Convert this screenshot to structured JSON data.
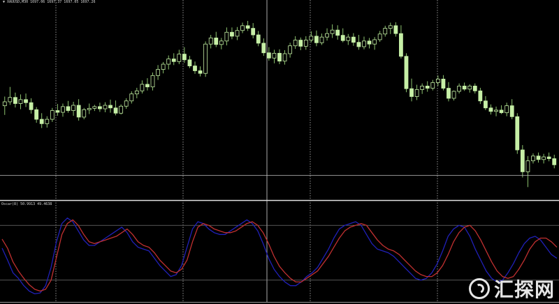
{
  "main_chart": {
    "label": "XAUUSD,M30  1697.06 1697.37 1697.05 1697.26",
    "theme": {
      "background": "#000000",
      "candle": "#c6efa6",
      "wick": "#9bd67a",
      "grid": "#d0d0d0"
    }
  },
  "oscillator": {
    "label": "Oscar(8) 50.9913 49.4638",
    "levels": [
      20,
      80
    ],
    "main_line_color": "#c03030",
    "signal_line_color": "#2020b8"
  },
  "watermark": {
    "text": "汇探网",
    "logo_icon": "ring-logo-icon"
  },
  "chart_data": {
    "type": "candlestick",
    "title": "XAUUSD,M30",
    "price_levels": {
      "top": 1712.0,
      "bottom": 1668.0
    },
    "horizontal_line": 1673.2,
    "candles": [
      [
        1689.1,
        1691.2,
        1687.0,
        1690.0
      ],
      [
        1690.0,
        1693.4,
        1689.3,
        1691.0
      ],
      [
        1691.0,
        1692.1,
        1688.7,
        1689.6
      ],
      [
        1689.6,
        1691.7,
        1688.3,
        1690.5
      ],
      [
        1690.5,
        1691.9,
        1688.8,
        1689.8
      ],
      [
        1689.8,
        1690.8,
        1687.3,
        1688.2
      ],
      [
        1688.2,
        1688.8,
        1685.2,
        1686.0
      ],
      [
        1686.0,
        1687.4,
        1684.0,
        1685.0
      ],
      [
        1685.0,
        1686.7,
        1684.1,
        1686.0
      ],
      [
        1686.0,
        1688.6,
        1685.4,
        1688.0
      ],
      [
        1688.0,
        1689.5,
        1686.8,
        1687.6
      ],
      [
        1687.6,
        1689.6,
        1686.6,
        1688.9
      ],
      [
        1688.9,
        1690.2,
        1687.5,
        1688.0
      ],
      [
        1688.0,
        1690.0,
        1686.8,
        1689.2
      ],
      [
        1689.2,
        1690.6,
        1685.7,
        1686.5
      ],
      [
        1686.5,
        1688.6,
        1686.0,
        1688.2
      ],
      [
        1688.2,
        1689.6,
        1687.2,
        1688.5
      ],
      [
        1688.5,
        1689.3,
        1687.9,
        1688.9
      ],
      [
        1688.9,
        1689.8,
        1687.7,
        1688.4
      ],
      [
        1688.4,
        1689.9,
        1687.6,
        1689.2
      ],
      [
        1689.2,
        1690.5,
        1687.5,
        1688.6
      ],
      [
        1688.6,
        1690.3,
        1686.9,
        1687.4
      ],
      [
        1687.4,
        1689.4,
        1687.1,
        1689.0
      ],
      [
        1689.0,
        1690.8,
        1688.4,
        1690.2
      ],
      [
        1690.2,
        1692.4,
        1689.6,
        1691.8
      ],
      [
        1691.8,
        1693.2,
        1690.8,
        1692.5
      ],
      [
        1692.5,
        1694.9,
        1691.9,
        1694.0
      ],
      [
        1694.0,
        1695.4,
        1692.6,
        1693.4
      ],
      [
        1693.4,
        1696.7,
        1692.6,
        1696.0
      ],
      [
        1696.0,
        1698.4,
        1695.0,
        1697.4
      ],
      [
        1697.4,
        1699.1,
        1696.5,
        1698.6
      ],
      [
        1698.6,
        1700.6,
        1697.4,
        1699.8
      ],
      [
        1699.8,
        1701.1,
        1698.4,
        1699.2
      ],
      [
        1699.2,
        1701.9,
        1698.6,
        1700.9
      ],
      [
        1700.9,
        1702.5,
        1698.9,
        1699.6
      ],
      [
        1699.6,
        1700.5,
        1697.7,
        1698.2
      ],
      [
        1698.2,
        1699.2,
        1696.4,
        1697.1
      ],
      [
        1697.1,
        1698.1,
        1695.8,
        1696.5
      ],
      [
        1696.5,
        1703.8,
        1695.7,
        1703.2
      ],
      [
        1703.2,
        1705.3,
        1702.2,
        1704.6
      ],
      [
        1704.6,
        1706.0,
        1702.5,
        1703.1
      ],
      [
        1703.1,
        1704.6,
        1702.0,
        1703.9
      ],
      [
        1703.9,
        1707.0,
        1702.9,
        1705.9
      ],
      [
        1705.9,
        1707.0,
        1704.3,
        1705.0
      ],
      [
        1705.0,
        1707.1,
        1704.1,
        1706.3
      ],
      [
        1706.3,
        1708.1,
        1705.7,
        1707.4
      ],
      [
        1707.4,
        1708.5,
        1706.2,
        1706.8
      ],
      [
        1706.8,
        1708.0,
        1704.5,
        1705.3
      ],
      [
        1705.3,
        1706.2,
        1702.7,
        1703.4
      ],
      [
        1703.4,
        1704.5,
        1700.5,
        1701.2
      ],
      [
        1701.2,
        1702.5,
        1699.4,
        1700.0
      ],
      [
        1700.0,
        1701.9,
        1698.8,
        1701.1
      ],
      [
        1701.1,
        1702.0,
        1698.6,
        1699.3
      ],
      [
        1699.3,
        1701.8,
        1698.5,
        1701.0
      ],
      [
        1701.0,
        1703.5,
        1700.1,
        1702.8
      ],
      [
        1702.8,
        1705.0,
        1702.1,
        1704.1
      ],
      [
        1704.1,
        1704.7,
        1701.8,
        1702.7
      ],
      [
        1702.7,
        1705.0,
        1701.9,
        1704.1
      ],
      [
        1704.1,
        1706.1,
        1703.6,
        1705.0
      ],
      [
        1705.0,
        1706.3,
        1702.7,
        1703.5
      ],
      [
        1703.5,
        1705.6,
        1703.0,
        1704.8
      ],
      [
        1704.8,
        1706.8,
        1704.0,
        1705.6
      ],
      [
        1705.6,
        1707.7,
        1704.6,
        1706.4
      ],
      [
        1706.4,
        1707.5,
        1704.2,
        1705.2
      ],
      [
        1705.2,
        1706.8,
        1703.6,
        1704.0
      ],
      [
        1704.0,
        1705.5,
        1703.0,
        1704.8
      ],
      [
        1704.8,
        1705.7,
        1702.8,
        1703.6
      ],
      [
        1703.6,
        1705.3,
        1701.9,
        1702.6
      ],
      [
        1702.6,
        1704.9,
        1702.0,
        1703.9
      ],
      [
        1703.9,
        1704.6,
        1702.2,
        1703.2
      ],
      [
        1703.2,
        1704.8,
        1701.9,
        1704.2
      ],
      [
        1704.2,
        1706.2,
        1703.7,
        1705.5
      ],
      [
        1705.5,
        1707.4,
        1704.9,
        1706.8
      ],
      [
        1706.8,
        1708.1,
        1705.5,
        1707.4
      ],
      [
        1707.4,
        1708.2,
        1704.9,
        1705.6
      ],
      [
        1705.6,
        1707.5,
        1699.9,
        1700.4
      ],
      [
        1700.4,
        1701.1,
        1692.2,
        1693.0
      ],
      [
        1693.0,
        1695.3,
        1690.1,
        1691.2
      ],
      [
        1691.2,
        1693.9,
        1690.4,
        1692.8
      ],
      [
        1692.8,
        1694.2,
        1691.8,
        1693.6
      ],
      [
        1693.6,
        1694.7,
        1692.3,
        1693.1
      ],
      [
        1693.1,
        1695.0,
        1692.6,
        1694.4
      ],
      [
        1694.4,
        1696.0,
        1693.6,
        1695.2
      ],
      [
        1695.2,
        1696.1,
        1692.6,
        1693.1
      ],
      [
        1693.1,
        1694.5,
        1690.1,
        1690.8
      ],
      [
        1690.8,
        1692.6,
        1690.3,
        1692.4
      ],
      [
        1692.4,
        1694.2,
        1691.9,
        1693.6
      ],
      [
        1693.6,
        1694.4,
        1692.5,
        1692.9
      ],
      [
        1692.9,
        1694.0,
        1692.1,
        1693.6
      ],
      [
        1693.6,
        1694.2,
        1691.9,
        1692.5
      ],
      [
        1692.5,
        1693.2,
        1689.5,
        1690.2
      ],
      [
        1690.2,
        1691.3,
        1688.1,
        1688.6
      ],
      [
        1688.6,
        1689.4,
        1687.1,
        1687.8
      ],
      [
        1687.8,
        1688.9,
        1686.7,
        1688.1
      ],
      [
        1688.1,
        1689.2,
        1687.2,
        1687.5
      ],
      [
        1687.5,
        1689.8,
        1686.7,
        1689.1
      ],
      [
        1689.1,
        1690.6,
        1686.0,
        1686.6
      ],
      [
        1686.6,
        1687.4,
        1678.1,
        1679.0
      ],
      [
        1679.0,
        1680.1,
        1672.7,
        1674.0
      ],
      [
        1674.0,
        1677.6,
        1670.5,
        1676.5
      ],
      [
        1676.5,
        1678.2,
        1675.9,
        1677.6
      ],
      [
        1677.6,
        1678.4,
        1676.1,
        1676.8
      ],
      [
        1676.8,
        1678.1,
        1675.9,
        1677.4
      ],
      [
        1677.4,
        1678.4,
        1676.4,
        1677.0
      ],
      [
        1677.0,
        1677.9,
        1674.8,
        1675.6
      ]
    ],
    "oscillator_series": [
      {
        "values": [
          65,
          55,
          40,
          30,
          22,
          15,
          10,
          8,
          10,
          20,
          45,
          70,
          82,
          86,
          80,
          70,
          62,
          60,
          62,
          64,
          66,
          68,
          72,
          76,
          70,
          62,
          58,
          56,
          50,
          42,
          36,
          30,
          28,
          32,
          42,
          62,
          78,
          82,
          80,
          76,
          74,
          72,
          72,
          74,
          78,
          82,
          84,
          80,
          72,
          60,
          46,
          35,
          28,
          22,
          18,
          18,
          22,
          26,
          30,
          38,
          46,
          56,
          66,
          74,
          78,
          80,
          82,
          80,
          72,
          64,
          58,
          54,
          52,
          48,
          42,
          36,
          30,
          26,
          24,
          24,
          28,
          36,
          48,
          62,
          72,
          78,
          80,
          74,
          64,
          52,
          40,
          30,
          24,
          22,
          24,
          32,
          42,
          54,
          62,
          66,
          66,
          62,
          56
        ]
      },
      {
        "values": [
          55,
          42,
          28,
          22,
          14,
          8,
          5,
          6,
          14,
          34,
          62,
          82,
          88,
          84,
          74,
          64,
          58,
          58,
          62,
          66,
          70,
          74,
          78,
          72,
          62,
          56,
          54,
          52,
          44,
          36,
          30,
          24,
          26,
          36,
          56,
          76,
          84,
          82,
          76,
          72,
          70,
          70,
          74,
          78,
          82,
          86,
          82,
          74,
          60,
          44,
          32,
          24,
          18,
          14,
          14,
          18,
          24,
          28,
          34,
          44,
          54,
          66,
          76,
          80,
          82,
          84,
          80,
          70,
          60,
          54,
          52,
          50,
          46,
          40,
          34,
          28,
          22,
          20,
          22,
          28,
          38,
          52,
          68,
          76,
          80,
          78,
          68,
          54,
          42,
          30,
          22,
          18,
          20,
          28,
          38,
          50,
          60,
          66,
          68,
          64,
          56,
          48,
          44
        ]
      }
    ]
  }
}
